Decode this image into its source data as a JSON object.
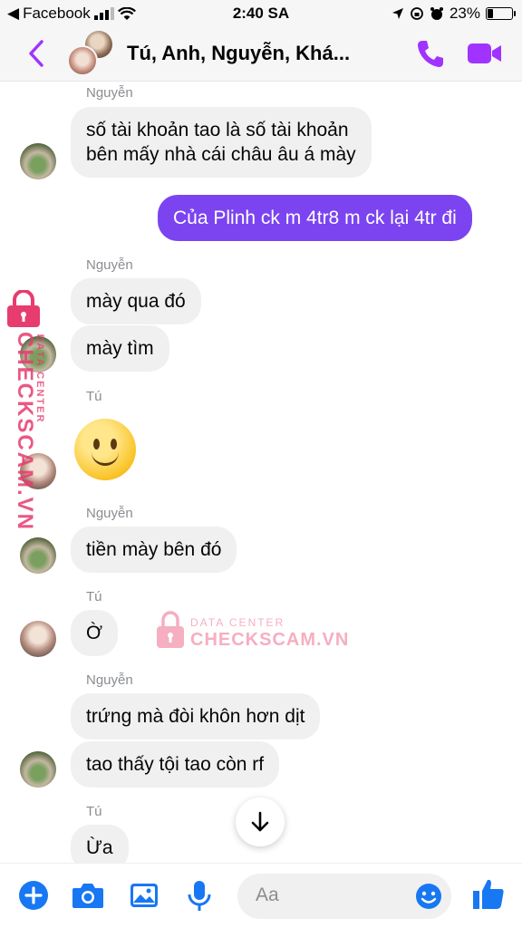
{
  "status_bar": {
    "back_app": "Facebook",
    "time": "2:40 SA",
    "battery": "23%",
    "battery_level": 0.23
  },
  "header": {
    "title": "Tú, Anh, Nguyễn, Khá..."
  },
  "messages": [
    {
      "sender": "Nguyễn",
      "text": "số tài khoản tao là số tài khoản\nbên mấy nhà cái châu âu á mày",
      "direction": "in"
    },
    {
      "text": "Của Plinh ck m 4tr8 m ck lại 4tr đi",
      "direction": "out"
    },
    {
      "sender": "Nguyễn",
      "text": "mày qua đó",
      "direction": "in"
    },
    {
      "text": "mày tìm",
      "direction": "in"
    },
    {
      "sender": "Tú",
      "emoji": "slightly-smiling-face",
      "direction": "in"
    },
    {
      "sender": "Nguyễn",
      "text": "tiền mày bên đó",
      "direction": "in"
    },
    {
      "sender": "Tú",
      "text": "Ờ",
      "direction": "in"
    },
    {
      "sender": "Nguyễn",
      "text": "trứng mà đòi khôn hơn dịt",
      "direction": "in"
    },
    {
      "text": "tao thấy tội tao còn rf",
      "direction": "in"
    },
    {
      "sender": "Tú",
      "text": "Ừa",
      "direction": "in"
    }
  ],
  "watermark": {
    "line1": "DATA CENTER",
    "line2": "CHECKSCAM.VN"
  },
  "composer": {
    "placeholder": "Aa"
  },
  "colors": {
    "accent": "#7b44f0",
    "header_icons": "#a033ff",
    "bottom_icons": "#1877f2"
  }
}
